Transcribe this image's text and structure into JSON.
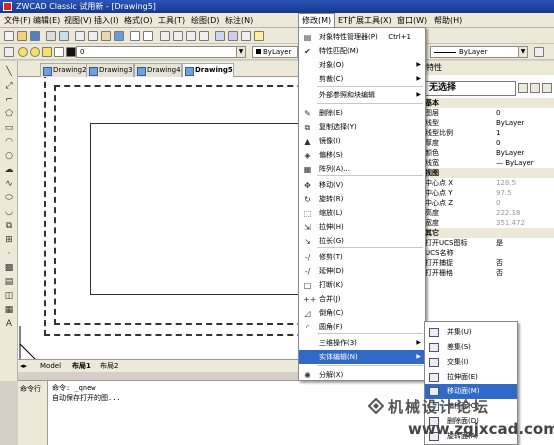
{
  "window": {
    "title": "ZWCAD Classic 试用新 - [Drawing5]"
  },
  "menubar": [
    {
      "label": "文件(F)"
    },
    {
      "label": "编辑(E)"
    },
    {
      "label": "视图(V)"
    },
    {
      "label": "插入(I)"
    },
    {
      "label": "格式(O)"
    },
    {
      "label": "工具(T)"
    },
    {
      "label": "绘图(D)"
    },
    {
      "label": "标注(N)"
    },
    {
      "label": "修改(M)",
      "active": true
    },
    {
      "label": "ET扩展工具(X)"
    },
    {
      "label": "窗口(W)"
    },
    {
      "label": "帮助(H)"
    }
  ],
  "toolbar": {
    "layer_value": "0",
    "color_value": "ByLayer",
    "linetype_value": "ByLayer",
    "lineweight_value": "ByLayer"
  },
  "doc_tabs": [
    {
      "label": "Drawing2"
    },
    {
      "label": "Drawing3"
    },
    {
      "label": "Drawing4"
    },
    {
      "label": "Drawing5",
      "active": true
    }
  ],
  "layout_tabs": [
    "Model",
    "布局1",
    "布局2"
  ],
  "command": {
    "label": "命令行",
    "lines": [
      "命令: _qnew",
      "自动保存打开的图..."
    ]
  },
  "properties": {
    "title": "特性",
    "selection": "无选择",
    "rows": [
      {
        "key": "基本",
        "section": true
      },
      {
        "key": "图层",
        "value": "0"
      },
      {
        "key": "线型",
        "value": "ByLayer"
      },
      {
        "key": "线型比例",
        "value": "1"
      },
      {
        "key": "厚度",
        "value": "0"
      },
      {
        "key": "颜色",
        "value": "ByLayer"
      },
      {
        "key": "线宽",
        "value": "— ByLayer"
      },
      {
        "key": "视图",
        "section": true
      },
      {
        "key": "中心点 X",
        "value": "128.5",
        "gray": true
      },
      {
        "key": "中心点 Y",
        "value": "97.5",
        "gray": true
      },
      {
        "key": "中心点 Z",
        "value": "0",
        "gray": true
      },
      {
        "key": "高度",
        "value": "222.18",
        "gray": true
      },
      {
        "key": "宽度",
        "value": "351.472",
        "gray": true
      },
      {
        "key": "其它",
        "section": true
      },
      {
        "key": "打开UCS图标",
        "value": "是"
      },
      {
        "key": "UCS名称",
        "value": ""
      },
      {
        "key": "打开捕捉",
        "value": "否"
      },
      {
        "key": "打开栅格",
        "value": "否"
      }
    ]
  },
  "modify_menu": {
    "items": [
      {
        "icon": "properties-icon",
        "glyph": "▤",
        "label": "对象特性管理器(P)",
        "shortcut": "Ctrl+1"
      },
      {
        "icon": "match-properties-icon",
        "glyph": "✔",
        "label": "特性匹配(M)"
      },
      {
        "icon": "",
        "glyph": "",
        "label": "对象(O)",
        "submenu": true
      },
      {
        "icon": "",
        "glyph": "",
        "label": "剪裁(C)",
        "submenu": true
      },
      {
        "icon": "",
        "glyph": "",
        "label": "外部参照和块编辑",
        "submenu": true
      },
      {
        "icon": "erase-icon",
        "glyph": "✎",
        "label": "删除(E)"
      },
      {
        "icon": "copy-icon",
        "glyph": "⧉",
        "label": "复制选择(Y)"
      },
      {
        "icon": "mirror-icon",
        "glyph": "▲",
        "label": "镜像(I)"
      },
      {
        "icon": "offset-icon",
        "glyph": "◈",
        "label": "偏移(S)"
      },
      {
        "icon": "array-icon",
        "glyph": "▦",
        "label": "阵列(A)..."
      },
      {
        "icon": "move-icon",
        "glyph": "✥",
        "label": "移动(V)"
      },
      {
        "icon": "rotate-icon",
        "glyph": "↻",
        "label": "旋转(R)"
      },
      {
        "icon": "scale-icon",
        "glyph": "⬚",
        "label": "缩放(L)"
      },
      {
        "icon": "stretch-icon",
        "glyph": "⇲",
        "label": "拉伸(H)"
      },
      {
        "icon": "lengthen-icon",
        "glyph": "↘",
        "label": "拉长(G)"
      },
      {
        "icon": "trim-icon",
        "glyph": "-/",
        "label": "修剪(T)"
      },
      {
        "icon": "extend-icon",
        "glyph": "-/",
        "label": "延伸(D)"
      },
      {
        "icon": "break-icon",
        "glyph": "□",
        "label": "打断(K)"
      },
      {
        "icon": "join-icon",
        "glyph": "++",
        "label": "合并(J)"
      },
      {
        "icon": "chamfer-icon",
        "glyph": "◿",
        "label": "倒角(C)"
      },
      {
        "icon": "fillet-icon",
        "glyph": "◜",
        "label": "圆角(F)"
      },
      {
        "icon": "",
        "glyph": "",
        "label": "三维操作(3)",
        "submenu": true
      },
      {
        "icon": "",
        "glyph": "",
        "label": "实体编辑(N)",
        "submenu": true,
        "highlight": true
      },
      {
        "icon": "explode-icon",
        "glyph": "✺",
        "label": "分解(X)"
      }
    ]
  },
  "solid_edit_submenu": {
    "items": [
      {
        "label": "并集(U)"
      },
      {
        "label": "差集(S)"
      },
      {
        "label": "交集(I)"
      },
      {
        "label": "拉伸面(E)"
      },
      {
        "label": "移动面(M)",
        "highlight": true
      },
      {
        "label": "偏移面(O)"
      },
      {
        "label": "删除面(D)"
      },
      {
        "label": "旋转面(A)"
      }
    ]
  },
  "watermark": {
    "line1": "机械设计论坛",
    "line2": "www.zgjxcad.com"
  },
  "colors": {
    "highlight": "#3169c6",
    "titlebar": "#17378f"
  }
}
